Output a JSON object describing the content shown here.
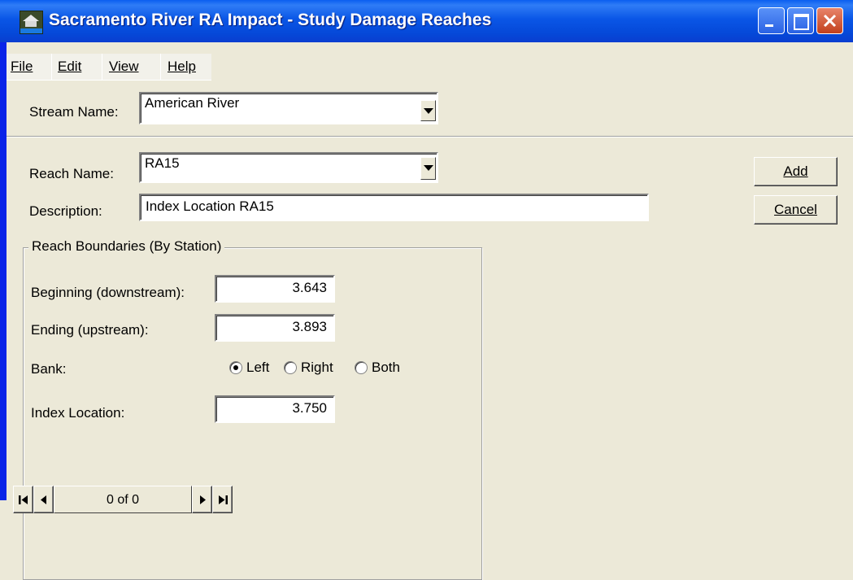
{
  "window": {
    "title": "Sacramento River RA Impact - Study Damage Reaches",
    "app_icon": "hec-app-icon",
    "controls": [
      "minimize-icon",
      "maximize-icon",
      "close-icon"
    ]
  },
  "menu": {
    "file": "File",
    "edit": "Edit",
    "view": "View",
    "help": "Help"
  },
  "stream": {
    "label": "Stream Name:",
    "value": "American River"
  },
  "reach": {
    "label": "Reach Name:",
    "value": "RA15"
  },
  "description": {
    "label": "Description:",
    "value": "Index Location RA15"
  },
  "buttons": {
    "add": "Add",
    "cancel": "Cancel"
  },
  "boundaries": {
    "legend": "Reach Boundaries (By Station)",
    "beginning_label": "Beginning (downstream):",
    "beginning_value": "3.643",
    "ending_label": "Ending (upstream):",
    "ending_value": "3.893",
    "bank_label": "Bank:",
    "bank_options": [
      "Left",
      "Right",
      "Both"
    ],
    "bank_selected": "Left",
    "index_label": "Index Location:",
    "index_value": "3.750"
  },
  "navigator": {
    "count": "0 of 0"
  },
  "colors": {
    "titlebar": "#0a56e6",
    "face": "#ece9d8",
    "close": "#c2401c"
  }
}
